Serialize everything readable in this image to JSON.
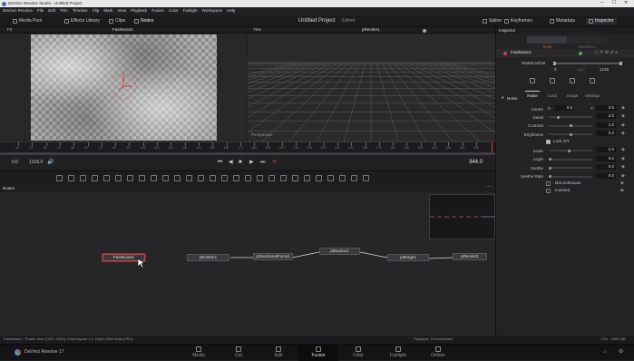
{
  "titlebar": {
    "app_title": "DaVinci Resolve Studio - Untitled Project"
  },
  "menu": [
    "DaVinci Resolve",
    "File",
    "Edit",
    "Trim",
    "Timeline",
    "Clip",
    "Mark",
    "View",
    "Playback",
    "Fusion",
    "Color",
    "Fairlight",
    "Workspace",
    "Help"
  ],
  "toolbar": {
    "media_pool": "Media Pool",
    "effects_library": "Effects Library",
    "clips": "Clips",
    "nodes": "Nodes",
    "project_title": "Untitled Project",
    "edited": "Edited",
    "spline": "Spline",
    "keyframes": "Keyframes",
    "metadata": "Metadata",
    "inspector": "Inspector"
  },
  "viewer": {
    "left_zoom": "Fit",
    "left_name": "FastNoise1",
    "right_zoom": "75%",
    "right_name": "pRender1",
    "perspective": "Perspective"
  },
  "timeline": {
    "ticks": [
      "10",
      "20",
      "30",
      "40",
      "50",
      "60",
      "70",
      "80",
      "90",
      "100",
      "110",
      "120",
      "130",
      "140",
      "150",
      "160",
      "170",
      "180",
      "190",
      "200",
      "210",
      "220",
      "230",
      "240",
      "250",
      "260",
      "270",
      "280",
      "290",
      "300",
      "310",
      "320",
      "330",
      "340"
    ],
    "start": "0.0",
    "end": "1216.0",
    "current": "344.0"
  },
  "nodes": {
    "header": "Nodes",
    "items": {
      "fastnoise": "FastNoise1",
      "pemitter": "pEmitter1",
      "pdirectional": "pDirectionalForce1",
      "pbounce": "pBounce1",
      "pmerge": "pMerge1",
      "prender": "pRender1"
    }
  },
  "status": {
    "left": "FastNoise1 - Frame Size (1920, 1080), Pixel Aspect 1:1, Depth 32bit float (GPU)",
    "center": "Playback: 24 frames/sec",
    "right": "17% - 2285 MB"
  },
  "pages": {
    "brand": "DaVinci Resolve 17",
    "items": [
      "Media",
      "Cut",
      "Edit",
      "Fusion",
      "Color",
      "Fairlight",
      "Deliver"
    ],
    "active": "Fusion"
  },
  "inspector": {
    "title": "Inspector",
    "tab_tools": "Tools",
    "tab_modifiers": "Modifiers",
    "tool_name": "FastNoise1",
    "global_inout": "Global In/Out",
    "in_value": "0",
    "out_value": "1216",
    "mid_value": "1217",
    "subtabs": [
      "Noise",
      "Color",
      "Image",
      "Settings"
    ],
    "section": "Noise",
    "center_label": "Center",
    "center_x_axis": "X",
    "center_x": "0.5",
    "center_y_axis": "Y",
    "center_y": "0.5",
    "params": [
      {
        "label": "Detail",
        "value": "2.0",
        "level": 0.2
      },
      {
        "label": "Contrast",
        "value": "1.0",
        "level": 0.5
      },
      {
        "label": "Brightness",
        "value": "0.0",
        "level": 0.5
      }
    ],
    "lock_xy": "Lock X/Y",
    "params2": [
      {
        "label": "Scale",
        "value": "2.0",
        "level": 0.45
      },
      {
        "label": "Angle",
        "value": "0.0",
        "level": 0.0
      },
      {
        "label": "Seethe",
        "value": "0.0",
        "level": 0.0
      },
      {
        "label": "Seethe Rate",
        "value": "0.0",
        "level": 0.0
      }
    ],
    "discontinuous": "Discontinuous",
    "inverted": "Inverted"
  },
  "colors": {
    "accent_red": "#e0393e",
    "active_tab": "#e05a22",
    "node_select": "#d24a4a"
  }
}
